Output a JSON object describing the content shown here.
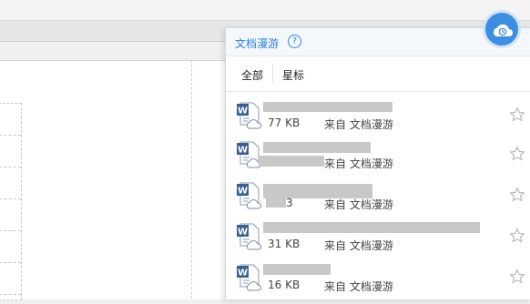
{
  "panel": {
    "title": "文档漫游",
    "help_icon": "help-icon",
    "tabs": [
      {
        "label": "全部",
        "active": true
      },
      {
        "label": "星标",
        "active": false
      }
    ]
  },
  "files": [
    {
      "size": "77 KB",
      "source": "来自 文档漫游",
      "icon": "word-doc-cloud-icon",
      "starred": false
    },
    {
      "size": "",
      "source": "来自 文档漫游",
      "icon": "word-doc-cloud-icon",
      "starred": false
    },
    {
      "size": "3",
      "source": "来自 文档漫游",
      "icon": "word-doc-cloud-icon",
      "starred": false
    },
    {
      "size": "31 KB",
      "source": "来自 文档漫游",
      "icon": "word-doc-cloud-icon",
      "starred": false
    },
    {
      "size": "16 KB",
      "source": "来自 文档漫游",
      "icon": "word-doc-cloud-icon",
      "starred": false
    }
  ],
  "colors": {
    "accent": "#2d83d9",
    "cloud_button": "#3c8ee0",
    "redaction": "#c8c8c8"
  }
}
